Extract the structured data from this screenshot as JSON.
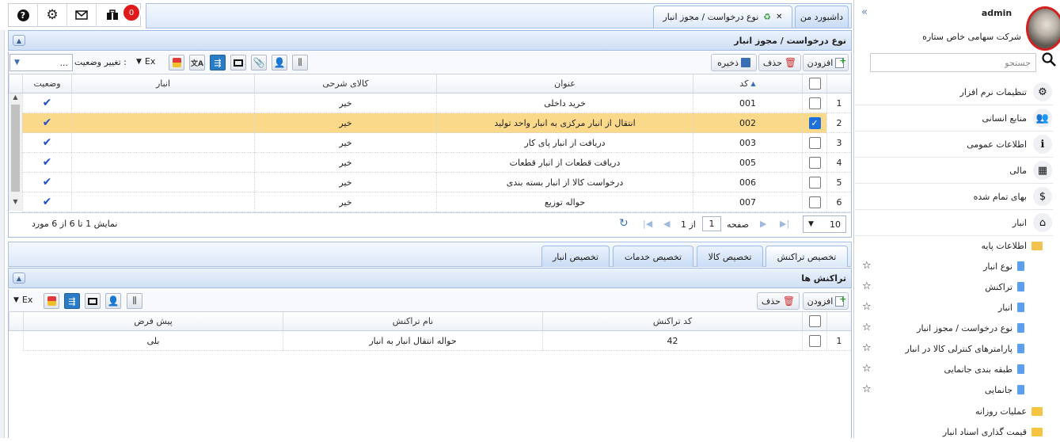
{
  "topbar": {
    "badge_count": "0"
  },
  "tabs": {
    "dashboard": "داشبورد من",
    "active": "نوع درخواست / مجوز انبار"
  },
  "panel1": {
    "title": "نوع درخواست / مجوز انبار",
    "toolbar": {
      "add": "افزودن",
      "delete": "حذف",
      "save": "ذخیره",
      "ex": "Ex",
      "status_change": "تغییر وضعیت :",
      "status_select": "..."
    },
    "columns": [
      "کد",
      "عنوان",
      "کالای شرحی",
      "انبار",
      "وضعیت"
    ],
    "rows": [
      {
        "n": "1",
        "code": "001",
        "title": "خرید داخلی",
        "desc": "خیر",
        "checked": false
      },
      {
        "n": "2",
        "code": "002",
        "title": "انتقال از انبار مرکزی به انبار واحد تولید",
        "desc": "خیر",
        "checked": true
      },
      {
        "n": "3",
        "code": "003",
        "title": "دریافت از انبار پای کار",
        "desc": "خیر",
        "checked": false
      },
      {
        "n": "4",
        "code": "005",
        "title": "دریافت قطعات از انبار قطعات",
        "desc": "خیر",
        "checked": false
      },
      {
        "n": "5",
        "code": "006",
        "title": "درخواست کالا از انبار بسته بندی",
        "desc": "خیر",
        "checked": false
      },
      {
        "n": "6",
        "code": "007",
        "title": "حواله توزیع",
        "desc": "خیر",
        "checked": false
      }
    ],
    "pager": {
      "page_size": "10",
      "page_label": "صفحه",
      "page": "1",
      "of": "از 1",
      "summary": "نمایش 1 تا 6 از 6 مورد"
    }
  },
  "subtabs": [
    "تخصیص تراکنش",
    "تخصیص کالا",
    "تخصیص خدمات",
    "تخصیص انبار"
  ],
  "panel2": {
    "title": "تراکنش ها",
    "toolbar": {
      "add": "افزودن",
      "delete": "حذف",
      "ex": "Ex"
    },
    "columns": [
      "کد تراکنش",
      "نام تراکنش",
      "پیش فرض"
    ],
    "rows": [
      {
        "n": "1",
        "code": "42",
        "name": "حواله انتقال انبار به انبار",
        "default": "بلی"
      }
    ]
  },
  "sidebar": {
    "user": "admin",
    "company": "شرکت سهامی خاص ستاره",
    "search_placeholder": "جستجو",
    "menu": [
      {
        "label": "تنظیمات نرم افزار",
        "icon": "gear-icon"
      },
      {
        "label": "منابع انسانی",
        "icon": "users-icon"
      },
      {
        "label": "اطلاعات عمومی",
        "icon": "info-icon"
      },
      {
        "label": "مالی",
        "icon": "calculator-icon"
      },
      {
        "label": "بهای تمام شده",
        "icon": "dollar-icon"
      },
      {
        "label": "انبار",
        "icon": "home-icon"
      }
    ],
    "tree_header": "اطلاعات پایه",
    "tree": [
      "نوع انبار",
      "تراکنش",
      "انبار",
      "نوع درخواست / مجوز انبار",
      "پارامترهای کنترلی کالا در انبار",
      "طبقه بندی جانمایی",
      "جانمایی"
    ],
    "folders": [
      "عملیات روزانه",
      "قیمت گذاری اسناد انبار"
    ]
  }
}
